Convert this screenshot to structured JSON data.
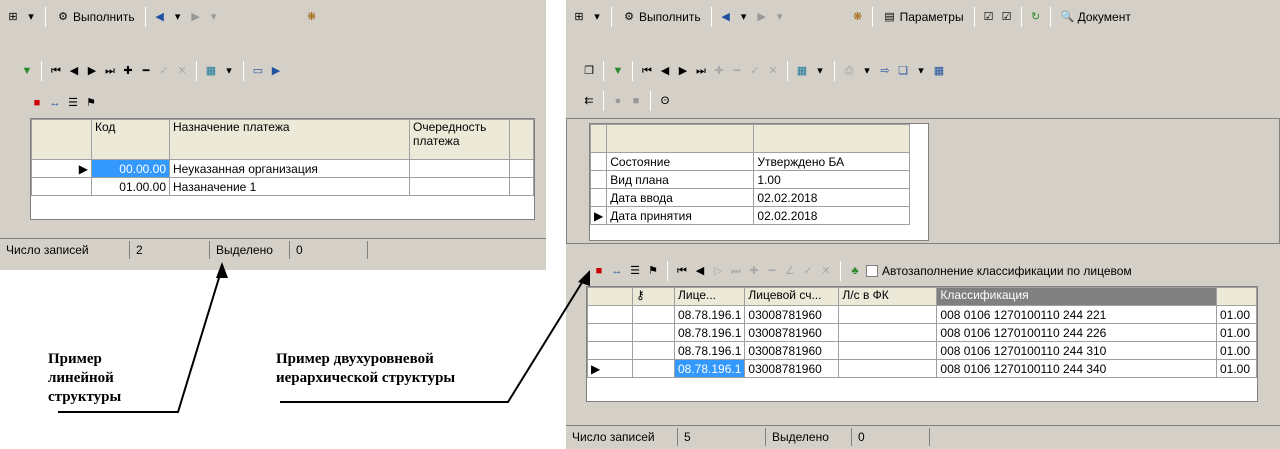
{
  "left": {
    "toolbar1": {
      "execute_label": "Выполнить"
    },
    "grid": {
      "headers": [
        "Код",
        "Назначение платежа",
        "Очередность платежа"
      ],
      "rows": [
        {
          "code": "00.00.00",
          "name": "Неуказанная организация"
        },
        {
          "code": "01.00.00",
          "name": "Назаначение 1"
        }
      ]
    },
    "status": {
      "records_label": "Число записей",
      "records_value": "2",
      "selected_label": "Выделено",
      "selected_value": "0"
    }
  },
  "right": {
    "toolbar1": {
      "execute_label": "Выполнить",
      "params_label": "Параметры",
      "document_label": "Документ"
    },
    "form": [
      {
        "label": "Состояние",
        "value": "Утверждено БА"
      },
      {
        "label": "Вид плана",
        "value": "1.00"
      },
      {
        "label": "Дата ввода",
        "value": "02.02.2018"
      },
      {
        "label": "Дата принятия",
        "value": "02.02.2018"
      }
    ],
    "autofill_label": "Автозаполнение классификации по лицевом",
    "grid": {
      "headers": [
        "Лице...",
        "Лицевой сч...",
        "Л/с в ФК",
        "Классификация"
      ],
      "rows": [
        {
          "a": "08.78.196.1",
          "b": "03008781960",
          "c": "",
          "d": "008 0106 1270100110 244 221",
          "e": "01.00"
        },
        {
          "a": "08.78.196.1",
          "b": "03008781960",
          "c": "",
          "d": "008 0106 1270100110 244 226",
          "e": "01.00"
        },
        {
          "a": "08.78.196.1",
          "b": "03008781960",
          "c": "",
          "d": "008 0106 1270100110 244 310",
          "e": "01.00"
        },
        {
          "a": "08.78.196.1",
          "b": "03008781960",
          "c": "",
          "d": "008 0106 1270100110 244 340",
          "e": "01.00"
        }
      ]
    },
    "status": {
      "records_label": "Число записей",
      "records_value": "5",
      "selected_label": "Выделено",
      "selected_value": "0"
    }
  },
  "captions": {
    "linear": "Пример линейной структуры",
    "two_level": "Пример двухуровневой иерархической структуры"
  }
}
